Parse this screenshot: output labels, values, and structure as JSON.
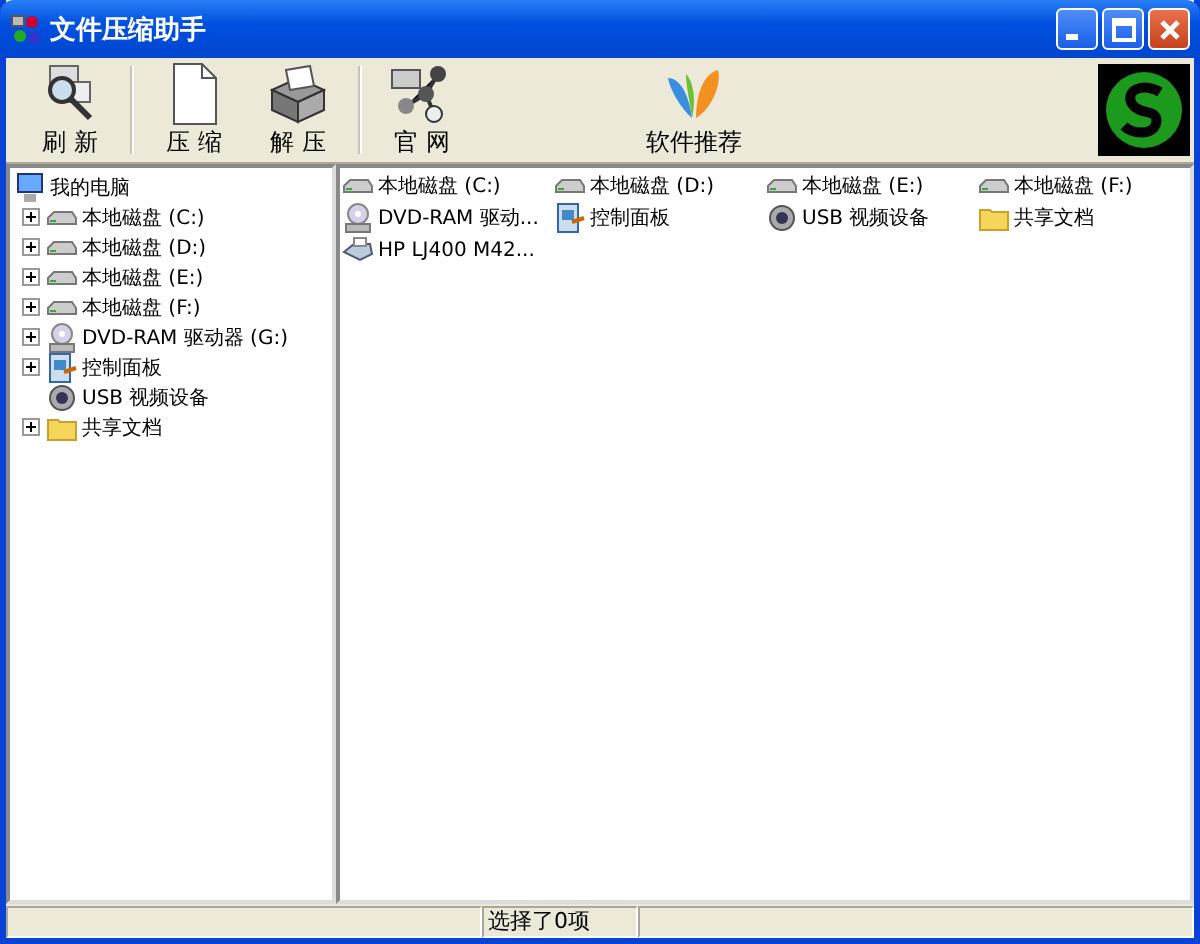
{
  "window": {
    "title": "文件压缩助手"
  },
  "toolbar": [
    {
      "label": "刷 新",
      "kind": "refresh"
    },
    {
      "kind": "separator"
    },
    {
      "label": "压 缩",
      "kind": "compress"
    },
    {
      "label": "解 压",
      "kind": "extract"
    },
    {
      "kind": "separator"
    },
    {
      "label": "官 网",
      "kind": "website"
    },
    {
      "label": "软件推荐",
      "kind": "recommend"
    }
  ],
  "tree": {
    "label": "我的电脑",
    "kind": "computer",
    "children": [
      {
        "label": "本地磁盘 (C:)",
        "kind": "drive",
        "expandable": true
      },
      {
        "label": "本地磁盘 (D:)",
        "kind": "drive",
        "expandable": true
      },
      {
        "label": "本地磁盘 (E:)",
        "kind": "drive",
        "expandable": true
      },
      {
        "label": "本地磁盘 (F:)",
        "kind": "drive",
        "expandable": true
      },
      {
        "label": "DVD-RAM 驱动器 (G:)",
        "kind": "dvd",
        "expandable": true
      },
      {
        "label": "控制面板",
        "kind": "control",
        "expandable": true
      },
      {
        "label": "USB 视频设备",
        "kind": "usb",
        "expandable": false
      },
      {
        "label": "共享文档",
        "kind": "folder",
        "expandable": true
      }
    ]
  },
  "items": [
    {
      "label": "本地磁盘 (C:)",
      "kind": "drive"
    },
    {
      "label": "本地磁盘 (D:)",
      "kind": "drive"
    },
    {
      "label": "本地磁盘 (E:)",
      "kind": "drive"
    },
    {
      "label": "本地磁盘 (F:)",
      "kind": "drive"
    },
    {
      "label": "DVD-RAM 驱动...",
      "kind": "dvd"
    },
    {
      "label": "控制面板",
      "kind": "control"
    },
    {
      "label": "USB 视频设备",
      "kind": "usb"
    },
    {
      "label": "共享文档",
      "kind": "folder"
    },
    {
      "label": "HP LJ400 M42...",
      "kind": "printer"
    }
  ],
  "status_bar": {
    "text": "选择了0项"
  }
}
